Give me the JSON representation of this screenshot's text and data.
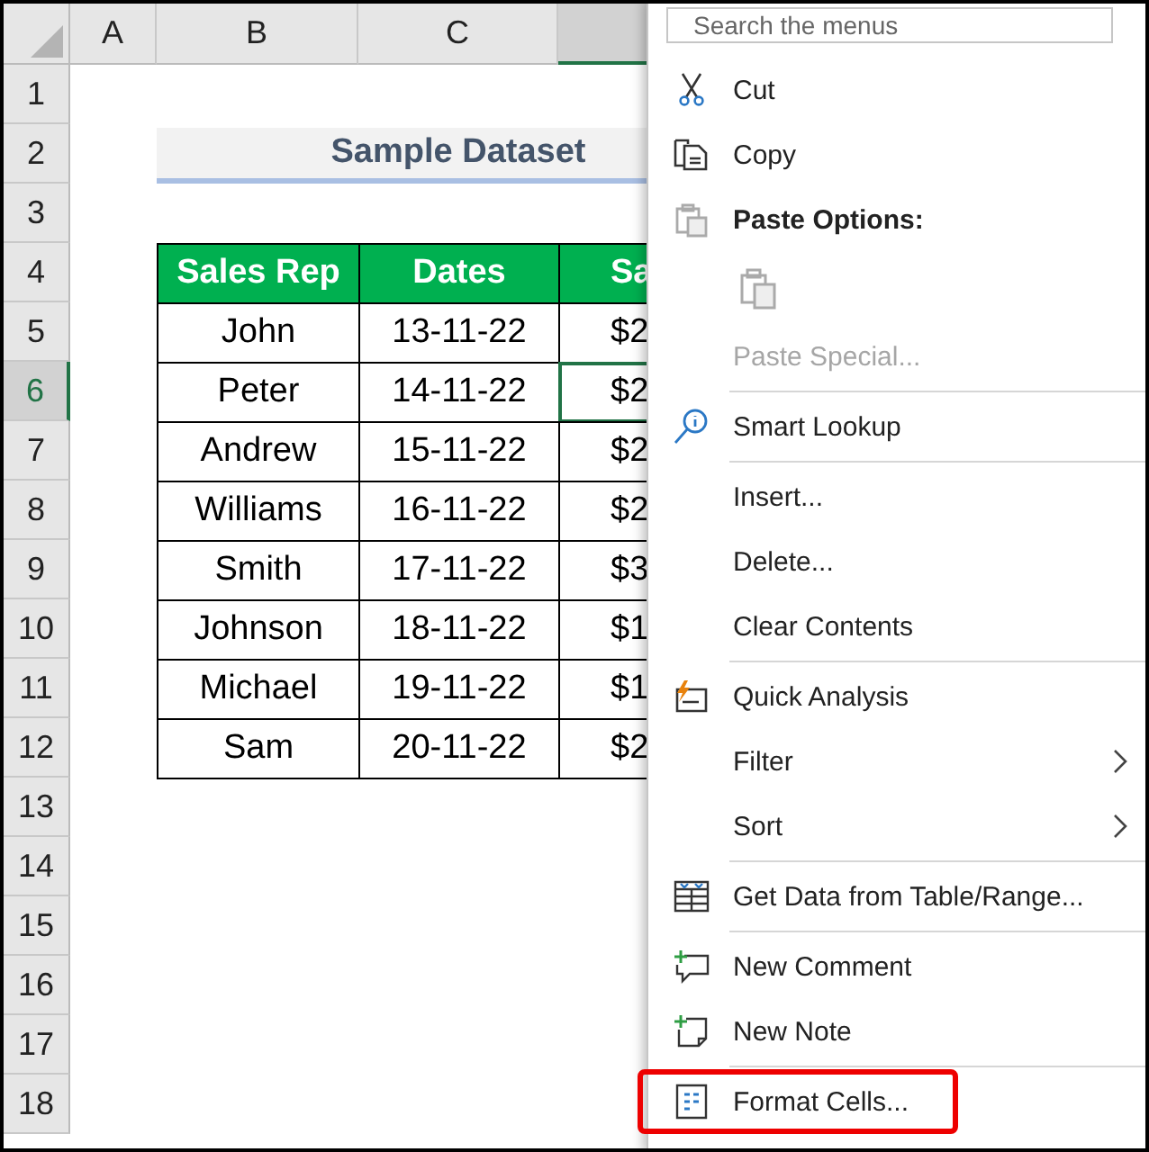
{
  "sheet": {
    "column_headers": [
      {
        "label": "A",
        "selected": false
      },
      {
        "label": "B",
        "selected": false
      },
      {
        "label": "C",
        "selected": false
      },
      {
        "selected": true
      }
    ],
    "row_headers": [
      {
        "label": "1",
        "selected": false
      },
      {
        "label": "2",
        "selected": false
      },
      {
        "label": "3",
        "selected": false
      },
      {
        "label": "4",
        "selected": false
      },
      {
        "label": "5",
        "selected": false
      },
      {
        "label": "6",
        "selected": true
      },
      {
        "label": "7",
        "selected": false
      },
      {
        "label": "8",
        "selected": false
      },
      {
        "label": "9",
        "selected": false
      },
      {
        "label": "10",
        "selected": false
      },
      {
        "label": "11",
        "selected": false
      },
      {
        "label": "12",
        "selected": false
      },
      {
        "label": "13",
        "selected": false
      },
      {
        "label": "14",
        "selected": false
      },
      {
        "label": "15",
        "selected": false
      },
      {
        "label": "16",
        "selected": false
      },
      {
        "label": "17",
        "selected": false
      },
      {
        "label": "18",
        "selected": false
      }
    ],
    "title": "Sample Dataset",
    "table": {
      "columns": [
        "Sales Rep",
        "Dates",
        "Sa"
      ],
      "rows": [
        {
          "name": "John",
          "date": "13-11-22",
          "sales": "$2",
          "selected": false
        },
        {
          "name": "Peter",
          "date": "14-11-22",
          "sales": "$2",
          "selected": true
        },
        {
          "name": "Andrew",
          "date": "15-11-22",
          "sales": "$2",
          "selected": false
        },
        {
          "name": "Williams",
          "date": "16-11-22",
          "sales": "$2",
          "selected": false
        },
        {
          "name": "Smith",
          "date": "17-11-22",
          "sales": "$3",
          "selected": false
        },
        {
          "name": "Johnson",
          "date": "18-11-22",
          "sales": "$1",
          "selected": false
        },
        {
          "name": "Michael",
          "date": "19-11-22",
          "sales": "$1",
          "selected": false
        },
        {
          "name": "Sam",
          "date": "20-11-22",
          "sales": "$2",
          "selected": false
        }
      ]
    }
  },
  "context_menu": {
    "search": {
      "placeholder": "Search the menus"
    },
    "items": [
      {
        "kind": "command",
        "label": "Cut",
        "disabled": false
      },
      {
        "kind": "command",
        "label": "Copy",
        "disabled": false
      },
      {
        "kind": "heading",
        "label": "Paste Options:"
      },
      {
        "kind": "paste-icons"
      },
      {
        "kind": "command",
        "label": "Paste Special...",
        "disabled": true
      },
      {
        "kind": "separator"
      },
      {
        "kind": "command",
        "label": "Smart Lookup",
        "disabled": false
      },
      {
        "kind": "separator"
      },
      {
        "kind": "command",
        "label": "Insert...",
        "disabled": false
      },
      {
        "kind": "command",
        "label": "Delete...",
        "disabled": false
      },
      {
        "kind": "command",
        "label": "Clear Contents",
        "disabled": false
      },
      {
        "kind": "separator"
      },
      {
        "kind": "command",
        "label": "Quick Analysis",
        "disabled": false
      },
      {
        "kind": "submenu",
        "label": "Filter",
        "disabled": false
      },
      {
        "kind": "submenu",
        "label": "Sort",
        "disabled": false
      },
      {
        "kind": "separator"
      },
      {
        "kind": "command",
        "label": "Get Data from Table/Range...",
        "disabled": false
      },
      {
        "kind": "separator"
      },
      {
        "kind": "command",
        "label": "New Comment",
        "disabled": false
      },
      {
        "kind": "command",
        "label": "New Note",
        "disabled": false
      },
      {
        "kind": "separator"
      },
      {
        "kind": "command",
        "label": "Format Cells...",
        "disabled": false,
        "highlighted": true
      }
    ]
  }
}
